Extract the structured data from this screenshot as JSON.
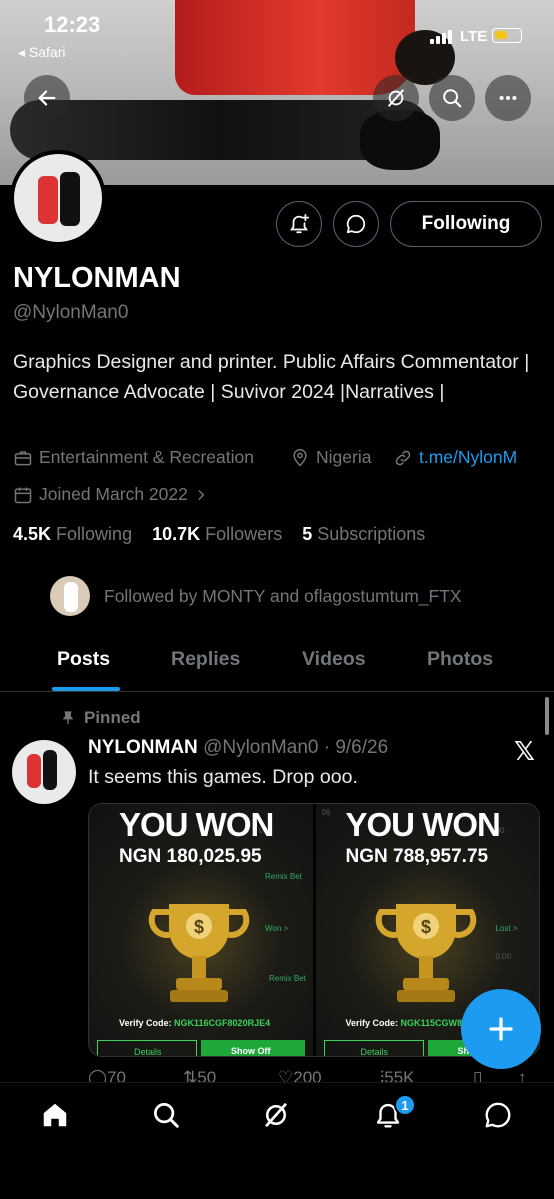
{
  "status_bar": {
    "time": "12:23",
    "back_app": "◂ Safari",
    "network": "LTE",
    "battery_level": 0.4
  },
  "header": {
    "back_icon": "arrow-left-icon",
    "grok_icon": "grok-icon",
    "search_icon": "search-icon",
    "more_icon": "more-icon"
  },
  "profile": {
    "name": "NYLONMAN",
    "handle": "@NylonMan0",
    "bio": "Graphics Designer and printer. Public Affairs Commentator | Governance Advocate | Suvivor 2024 |Narratives |",
    "category": "Entertainment & Recreation",
    "location": "Nigeria",
    "link": "t.me/NylonM",
    "joined": "Joined March 2022",
    "following_count": "4.5K",
    "following_label": "Following",
    "followers_count": "10.7K",
    "followers_label": "Followers",
    "subs_count": "5",
    "subs_label": "Subscriptions",
    "followed_by": "Followed by MONTY and oflagostumtum_FTX",
    "follow_button": "Following"
  },
  "tabs": [
    {
      "label": "Posts",
      "active": true
    },
    {
      "label": "Replies",
      "active": false
    },
    {
      "label": "Videos",
      "active": false
    },
    {
      "label": "Photos",
      "active": false
    }
  ],
  "post": {
    "pinned_label": "Pinned",
    "author": "NYLONMAN",
    "handle_date": "@NylonMan0 · 9/6/26",
    "text": "It seems this games. Drop ooo.",
    "media": [
      {
        "won": "YOU WON",
        "amount": "NGN 180,025.95",
        "verify_label": "Verify Code:",
        "verify_code": "NGK116CGF8020RJE4",
        "details": "Details",
        "show": "Show Off"
      },
      {
        "won": "YOU WON",
        "amount": "NGN 788,957.75",
        "verify_label": "Verify Code:",
        "verify_code": "NGK115CGW8",
        "details": "Details",
        "show": "Sh"
      }
    ],
    "replies": "70",
    "reposts": "50",
    "likes": "200",
    "views": "55K"
  },
  "nav": {
    "notification_badge": "1"
  },
  "colors": {
    "accent": "#1d9bf0",
    "background": "#000000",
    "muted": "#71767b"
  }
}
